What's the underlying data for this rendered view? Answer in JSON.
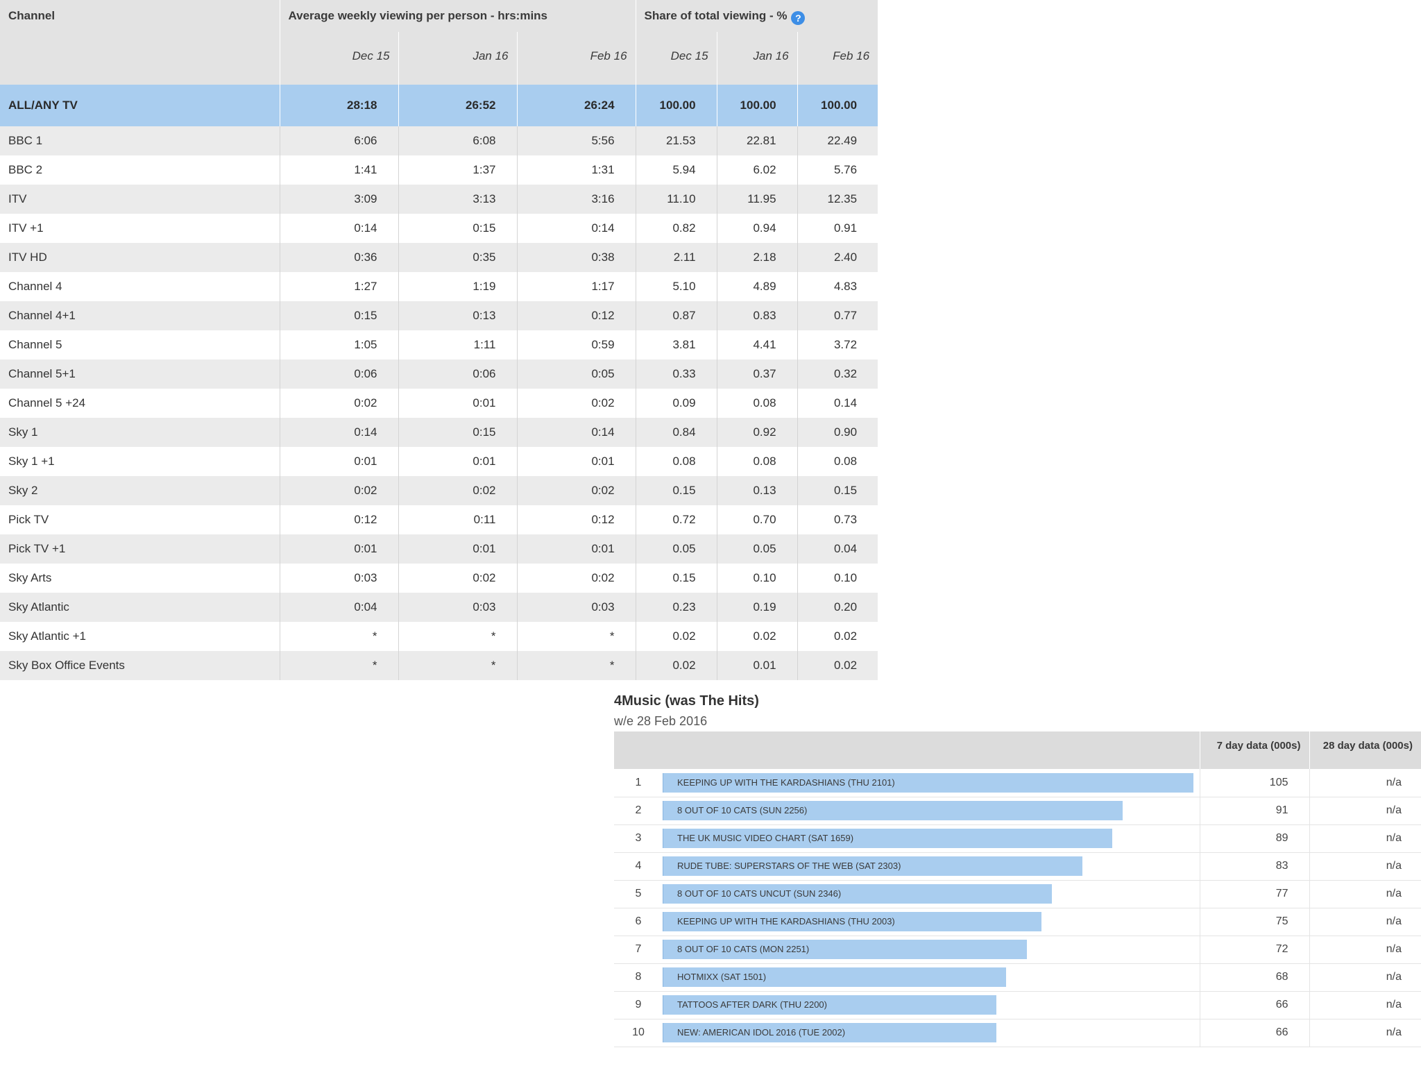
{
  "viewing": {
    "header": {
      "channel": "Channel",
      "avg_group": "Average weekly viewing per person - hrs:mins",
      "share_group": "Share of total viewing - %",
      "help_icon": "question-circle-icon",
      "months": [
        "Dec 15",
        "Jan 16",
        "Feb 16",
        "Dec 15",
        "Jan 16",
        "Feb 16"
      ]
    },
    "total": {
      "channel": "ALL/ANY TV",
      "values": [
        "28:18",
        "26:52",
        "26:24",
        "100.00",
        "100.00",
        "100.00"
      ]
    },
    "rows": [
      {
        "channel": "BBC 1",
        "values": [
          "6:06",
          "6:08",
          "5:56",
          "21.53",
          "22.81",
          "22.49"
        ]
      },
      {
        "channel": "BBC 2",
        "values": [
          "1:41",
          "1:37",
          "1:31",
          "5.94",
          "6.02",
          "5.76"
        ]
      },
      {
        "channel": "ITV",
        "values": [
          "3:09",
          "3:13",
          "3:16",
          "11.10",
          "11.95",
          "12.35"
        ]
      },
      {
        "channel": "ITV +1",
        "values": [
          "0:14",
          "0:15",
          "0:14",
          "0.82",
          "0.94",
          "0.91"
        ]
      },
      {
        "channel": "ITV HD",
        "values": [
          "0:36",
          "0:35",
          "0:38",
          "2.11",
          "2.18",
          "2.40"
        ]
      },
      {
        "channel": "Channel 4",
        "values": [
          "1:27",
          "1:19",
          "1:17",
          "5.10",
          "4.89",
          "4.83"
        ]
      },
      {
        "channel": "Channel 4+1",
        "values": [
          "0:15",
          "0:13",
          "0:12",
          "0.87",
          "0.83",
          "0.77"
        ]
      },
      {
        "channel": "Channel 5",
        "values": [
          "1:05",
          "1:11",
          "0:59",
          "3.81",
          "4.41",
          "3.72"
        ]
      },
      {
        "channel": "Channel 5+1",
        "values": [
          "0:06",
          "0:06",
          "0:05",
          "0.33",
          "0.37",
          "0.32"
        ]
      },
      {
        "channel": "Channel 5 +24",
        "values": [
          "0:02",
          "0:01",
          "0:02",
          "0.09",
          "0.08",
          "0.14"
        ]
      },
      {
        "channel": "Sky 1",
        "values": [
          "0:14",
          "0:15",
          "0:14",
          "0.84",
          "0.92",
          "0.90"
        ]
      },
      {
        "channel": "Sky 1 +1",
        "values": [
          "0:01",
          "0:01",
          "0:01",
          "0.08",
          "0.08",
          "0.08"
        ]
      },
      {
        "channel": "Sky 2",
        "values": [
          "0:02",
          "0:02",
          "0:02",
          "0.15",
          "0.13",
          "0.15"
        ]
      },
      {
        "channel": "Pick TV",
        "values": [
          "0:12",
          "0:11",
          "0:12",
          "0.72",
          "0.70",
          "0.73"
        ]
      },
      {
        "channel": "Pick TV +1",
        "values": [
          "0:01",
          "0:01",
          "0:01",
          "0.05",
          "0.05",
          "0.04"
        ]
      },
      {
        "channel": "Sky Arts",
        "values": [
          "0:03",
          "0:02",
          "0:02",
          "0.15",
          "0.10",
          "0.10"
        ]
      },
      {
        "channel": "Sky Atlantic",
        "values": [
          "0:04",
          "0:03",
          "0:03",
          "0.23",
          "0.19",
          "0.20"
        ]
      },
      {
        "channel": "Sky Atlantic +1",
        "values": [
          "*",
          "*",
          "*",
          "0.02",
          "0.02",
          "0.02"
        ]
      },
      {
        "channel": "Sky Box Office Events",
        "values": [
          "*",
          "*",
          "*",
          "0.02",
          "0.01",
          "0.02"
        ]
      }
    ]
  },
  "music": {
    "title": "4Music (was The Hits)",
    "subtitle": "w/e 28 Feb 2016",
    "col_7day": "7 day data (000s)",
    "col_28day": "28 day data (000s)",
    "max_value": 105,
    "rows": [
      {
        "rank": "1",
        "programme": "KEEPING UP WITH THE KARDASHIANS (THU 2101)",
        "d7": "105",
        "d28": "n/a",
        "value": 105
      },
      {
        "rank": "2",
        "programme": "8 OUT OF 10 CATS (SUN 2256)",
        "d7": "91",
        "d28": "n/a",
        "value": 91
      },
      {
        "rank": "3",
        "programme": "THE UK MUSIC VIDEO CHART (SAT 1659)",
        "d7": "89",
        "d28": "n/a",
        "value": 89
      },
      {
        "rank": "4",
        "programme": "RUDE TUBE: SUPERSTARS OF THE WEB (SAT 2303)",
        "d7": "83",
        "d28": "n/a",
        "value": 83
      },
      {
        "rank": "5",
        "programme": "8 OUT OF 10 CATS UNCUT (SUN 2346)",
        "d7": "77",
        "d28": "n/a",
        "value": 77
      },
      {
        "rank": "6",
        "programme": "KEEPING UP WITH THE KARDASHIANS (THU 2003)",
        "d7": "75",
        "d28": "n/a",
        "value": 75
      },
      {
        "rank": "7",
        "programme": "8 OUT OF 10 CATS (MON 2251)",
        "d7": "72",
        "d28": "n/a",
        "value": 72
      },
      {
        "rank": "8",
        "programme": "HOTMIXX (SAT 1501)",
        "d7": "68",
        "d28": "n/a",
        "value": 68
      },
      {
        "rank": "9",
        "programme": "TATTOOS AFTER DARK (THU 2200)",
        "d7": "66",
        "d28": "n/a",
        "value": 66
      },
      {
        "rank": "10",
        "programme": "NEW: AMERICAN IDOL 2016 (TUE 2002)",
        "d7": "66",
        "d28": "n/a",
        "value": 66
      }
    ]
  },
  "colors": {
    "highlight": "#a9cdef",
    "bar": "#a9cdef",
    "header_bg": "#e3e3e3",
    "stripe": "#ebebeb",
    "help_icon": "#3d8ee6"
  }
}
